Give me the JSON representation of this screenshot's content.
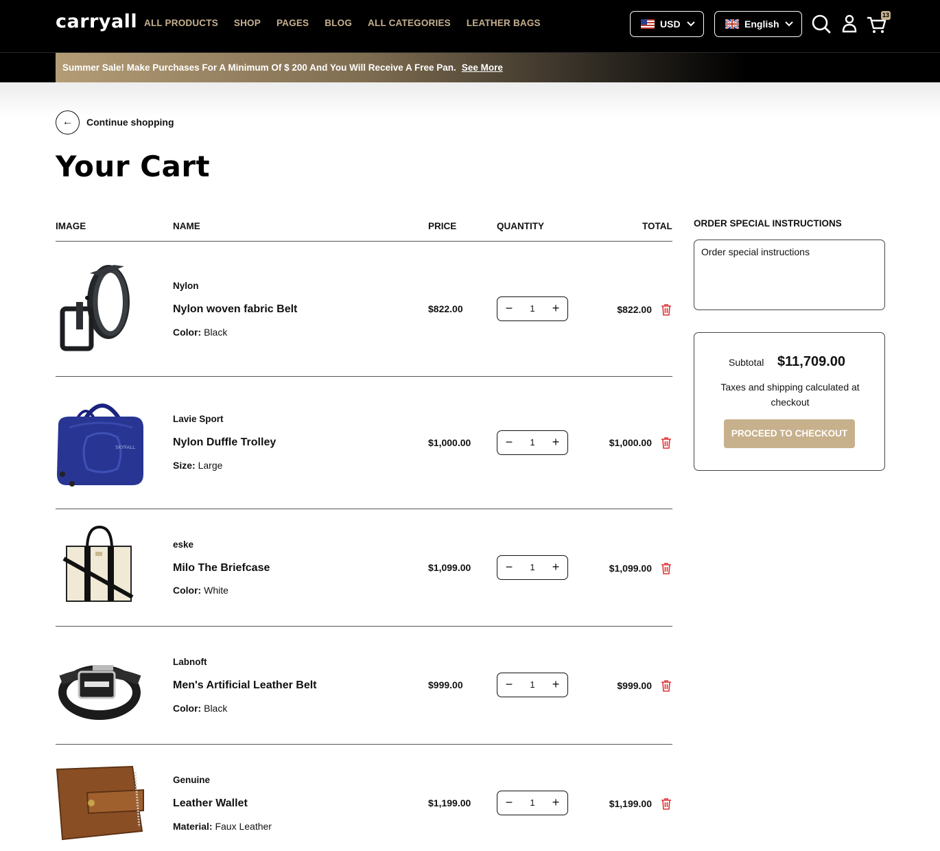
{
  "header": {
    "logo": "carryall",
    "nav": [
      "ALL PRODUCTS",
      "SHOP",
      "PAGES",
      "BLOG",
      "ALL CATEGORIES",
      "LEATHER BAGS"
    ],
    "currency": "USD",
    "language": "English",
    "cart_count": "13",
    "icons": [
      "us-flag-icon",
      "uk-flag-icon",
      "chevron-down-icon",
      "search-icon",
      "user-icon",
      "cart-icon"
    ]
  },
  "promo": {
    "text": "Summer Sale! Make Purchases For A Minimum Of $ 200 And You Will Receive A Free Pan.",
    "link": "See More"
  },
  "continue_label": "Continue shopping",
  "page_title": "Your Cart",
  "table": {
    "headers": {
      "image": "IMAGE",
      "name": "NAME",
      "price": "PRICE",
      "quantity": "QUANTITY",
      "total": "TOTAL"
    },
    "rows": [
      {
        "vendor": "Nylon",
        "name": "Nylon woven fabric Belt",
        "opt_label": "Color:",
        "opt_value": "Black",
        "price": "$822.00",
        "qty": "1",
        "total": "$822.00"
      },
      {
        "vendor": "Lavie Sport",
        "name": "Nylon Duffle Trolley",
        "opt_label": "Size:",
        "opt_value": "Large",
        "price": "$1,000.00",
        "qty": "1",
        "total": "$1,000.00"
      },
      {
        "vendor": "eske",
        "name": "Milo The Briefcase",
        "opt_label": "Color:",
        "opt_value": "White",
        "price": "$1,099.00",
        "qty": "1",
        "total": "$1,099.00"
      },
      {
        "vendor": "Labnoft",
        "name": "Men's Artificial Leather Belt",
        "opt_label": "Color:",
        "opt_value": "Black",
        "price": "$999.00",
        "qty": "1",
        "total": "$999.00"
      },
      {
        "vendor": "Genuine",
        "name": "Leather Wallet",
        "opt_label": "Material:",
        "opt_value": "Faux Leather",
        "price": "$1,199.00",
        "qty": "1",
        "total": "$1,199.00"
      }
    ]
  },
  "instructions": {
    "title": "ORDER SPECIAL INSTRUCTIONS",
    "placeholder": "Order special instructions"
  },
  "summary": {
    "subtotal_label": "Subtotal",
    "subtotal_value": "$11,709.00",
    "tax_note": "Taxes and shipping calculated at checkout",
    "checkout_label": "PROCEED TO CHECKOUT"
  },
  "colors": {
    "accent": "#c6b190",
    "button": "#c7b08c",
    "delete": "#e03131",
    "header_bg": "#000000"
  }
}
